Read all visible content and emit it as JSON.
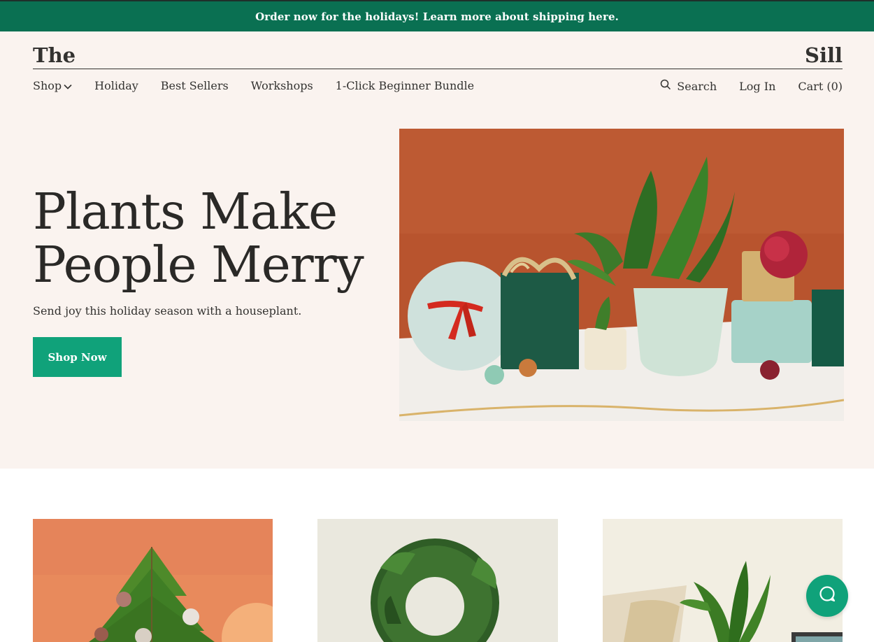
{
  "promo": {
    "text": "Order now for the holidays! Learn more about shipping here."
  },
  "logo": {
    "left": "The",
    "right": "Sill"
  },
  "nav": {
    "left": [
      {
        "label": "Shop",
        "has_dropdown": true
      },
      {
        "label": "Holiday"
      },
      {
        "label": "Best Sellers"
      },
      {
        "label": "Workshops"
      },
      {
        "label": "1-Click Beginner Bundle"
      }
    ],
    "search_label": "Search",
    "login_label": "Log In",
    "cart_label": "Cart (0)"
  },
  "hero": {
    "title_line1": "Plants Make",
    "title_line2": "People Merry",
    "subtitle": "Send joy this holiday season with a houseplant.",
    "cta_label": "Shop Now"
  },
  "icons": {
    "dropdown": "chevron-down-icon",
    "search": "search-icon",
    "help": "chat-help-icon"
  },
  "colors": {
    "brand_green": "#0a7052",
    "cta_green": "#10a27a",
    "cream_bg": "#faf3ef",
    "text_dark": "#333230"
  }
}
